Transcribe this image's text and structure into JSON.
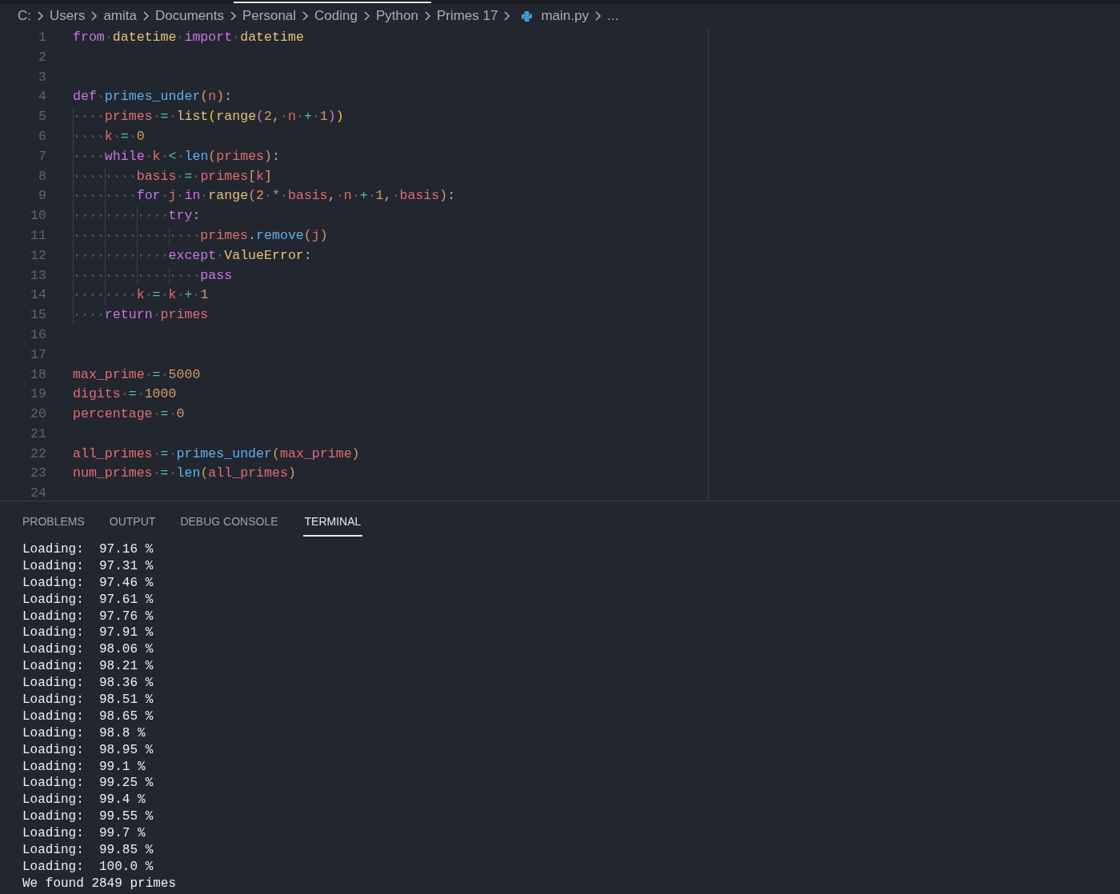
{
  "breadcrumb": [
    {
      "label": "C:",
      "kind": "folder"
    },
    {
      "label": "Users",
      "kind": "folder"
    },
    {
      "label": "amita",
      "kind": "folder"
    },
    {
      "label": "Documents",
      "kind": "folder"
    },
    {
      "label": "Personal",
      "kind": "folder"
    },
    {
      "label": "Coding",
      "kind": "folder"
    },
    {
      "label": "Python",
      "kind": "folder"
    },
    {
      "label": "Primes 17",
      "kind": "folder"
    },
    {
      "label": "main.py",
      "kind": "file"
    },
    {
      "label": "...",
      "kind": "more"
    }
  ],
  "editor": {
    "lines": [
      {
        "number": "1",
        "tokens": [
          {
            "text": "from",
            "kind": "kw"
          },
          {
            "text": " datetime",
            "kind": "type"
          },
          {
            "text": " import",
            "kind": "kw"
          },
          {
            "text": " datetime",
            "kind": "type"
          }
        ]
      },
      {
        "number": "2"
      },
      {
        "number": "3"
      },
      {
        "number": "4",
        "tokens": [
          {
            "text": "def",
            "kind": "kw"
          },
          {
            "text": " primes_under",
            "kind": "fn"
          },
          {
            "text": "(",
            "kind": "paren"
          },
          {
            "text": "n",
            "kind": "var"
          },
          {
            "text": ")",
            "kind": "paren"
          },
          {
            "text": ":",
            "kind": "punc"
          }
        ]
      },
      {
        "number": "5",
        "tokens": [
          {
            "text": "    primes",
            "kind": "var"
          },
          {
            "text": " =",
            "kind": "op"
          },
          {
            "text": " list",
            "kind": "type"
          },
          {
            "text": "(",
            "kind": "b1"
          },
          {
            "text": "range",
            "kind": "type"
          },
          {
            "text": "(",
            "kind": "b2"
          },
          {
            "text": "2",
            "kind": "num"
          },
          {
            "text": ",",
            "kind": "punc"
          },
          {
            "text": " n",
            "kind": "var"
          },
          {
            "text": " +",
            "kind": "op"
          },
          {
            "text": " 1",
            "kind": "num"
          },
          {
            "text": ")",
            "kind": "b2"
          },
          {
            "text": ")",
            "kind": "b1"
          }
        ]
      },
      {
        "number": "6",
        "tokens": [
          {
            "text": "    k",
            "kind": "var"
          },
          {
            "text": " =",
            "kind": "op"
          },
          {
            "text": " 0",
            "kind": "num"
          }
        ]
      },
      {
        "number": "7",
        "tokens": [
          {
            "text": "    while",
            "kind": "kw"
          },
          {
            "text": " k",
            "kind": "var"
          },
          {
            "text": " <",
            "kind": "op"
          },
          {
            "text": " len",
            "kind": "fn"
          },
          {
            "text": "(",
            "kind": "paren"
          },
          {
            "text": "primes",
            "kind": "var"
          },
          {
            "text": ")",
            "kind": "paren"
          },
          {
            "text": ":",
            "kind": "punc"
          }
        ]
      },
      {
        "number": "8",
        "tokens": [
          {
            "text": "        basis",
            "kind": "var"
          },
          {
            "text": " =",
            "kind": "op"
          },
          {
            "text": " primes",
            "kind": "var"
          },
          {
            "text": "[",
            "kind": "paren"
          },
          {
            "text": "k",
            "kind": "var"
          },
          {
            "text": "]",
            "kind": "paren"
          }
        ]
      },
      {
        "number": "9",
        "tokens": [
          {
            "text": "        for",
            "kind": "kw"
          },
          {
            "text": " j",
            "kind": "var"
          },
          {
            "text": " in",
            "kind": "kw"
          },
          {
            "text": " range",
            "kind": "type"
          },
          {
            "text": "(",
            "kind": "paren"
          },
          {
            "text": "2",
            "kind": "num"
          },
          {
            "text": " *",
            "kind": "op"
          },
          {
            "text": " basis",
            "kind": "var"
          },
          {
            "text": ",",
            "kind": "punc"
          },
          {
            "text": " n",
            "kind": "var"
          },
          {
            "text": " +",
            "kind": "op"
          },
          {
            "text": " 1",
            "kind": "num"
          },
          {
            "text": ",",
            "kind": "punc"
          },
          {
            "text": " basis",
            "kind": "var"
          },
          {
            "text": ")",
            "kind": "paren"
          },
          {
            "text": ":",
            "kind": "punc"
          }
        ]
      },
      {
        "number": "10",
        "tokens": [
          {
            "text": "            try",
            "kind": "kw"
          },
          {
            "text": ":",
            "kind": "punc"
          }
        ]
      },
      {
        "number": "11",
        "tokens": [
          {
            "text": "                primes",
            "kind": "var"
          },
          {
            "text": ".",
            "kind": "punc"
          },
          {
            "text": "remove",
            "kind": "fn"
          },
          {
            "text": "(",
            "kind": "paren"
          },
          {
            "text": "j",
            "kind": "var"
          },
          {
            "text": ")",
            "kind": "paren"
          }
        ]
      },
      {
        "number": "12",
        "tokens": [
          {
            "text": "            except",
            "kind": "kw"
          },
          {
            "text": " ValueError",
            "kind": "type"
          },
          {
            "text": ":",
            "kind": "punc"
          }
        ]
      },
      {
        "number": "13",
        "tokens": [
          {
            "text": "                pass",
            "kind": "kw"
          }
        ]
      },
      {
        "number": "14",
        "tokens": [
          {
            "text": "        k",
            "kind": "var"
          },
          {
            "text": " =",
            "kind": "op"
          },
          {
            "text": " k",
            "kind": "var"
          },
          {
            "text": " +",
            "kind": "op"
          },
          {
            "text": " 1",
            "kind": "num"
          }
        ]
      },
      {
        "number": "15",
        "tokens": [
          {
            "text": "    return",
            "kind": "kw"
          },
          {
            "text": " primes",
            "kind": "var"
          }
        ]
      },
      {
        "number": "16"
      },
      {
        "number": "17"
      },
      {
        "number": "18",
        "tokens": [
          {
            "text": "max_prime",
            "kind": "var"
          },
          {
            "text": " =",
            "kind": "op"
          },
          {
            "text": " 5000",
            "kind": "num"
          }
        ]
      },
      {
        "number": "19",
        "tokens": [
          {
            "text": "digits",
            "kind": "var"
          },
          {
            "text": " =",
            "kind": "op"
          },
          {
            "text": " 1000",
            "kind": "num"
          }
        ]
      },
      {
        "number": "20",
        "tokens": [
          {
            "text": "percentage",
            "kind": "var"
          },
          {
            "text": " =",
            "kind": "op"
          },
          {
            "text": " 0",
            "kind": "num"
          }
        ]
      },
      {
        "number": "21"
      },
      {
        "number": "22",
        "tokens": [
          {
            "text": "all_primes",
            "kind": "var"
          },
          {
            "text": " =",
            "kind": "op"
          },
          {
            "text": " primes_under",
            "kind": "fn"
          },
          {
            "text": "(",
            "kind": "paren"
          },
          {
            "text": "max_prime",
            "kind": "var"
          },
          {
            "text": ")",
            "kind": "paren"
          }
        ]
      },
      {
        "number": "23",
        "tokens": [
          {
            "text": "num_primes",
            "kind": "var"
          },
          {
            "text": " =",
            "kind": "op"
          },
          {
            "text": " len",
            "kind": "fn"
          },
          {
            "text": "(",
            "kind": "paren"
          },
          {
            "text": "all_primes",
            "kind": "var"
          },
          {
            "text": ")",
            "kind": "paren"
          }
        ]
      },
      {
        "number": "24"
      }
    ]
  },
  "panel": {
    "tabs": [
      {
        "label": "PROBLEMS",
        "selected": false
      },
      {
        "label": "OUTPUT",
        "selected": false
      },
      {
        "label": "DEBUG CONSOLE",
        "selected": false
      },
      {
        "label": "TERMINAL",
        "selected": true
      }
    ],
    "terminal_lines": [
      "Loading:  97.16 %",
      "Loading:  97.31 %",
      "Loading:  97.46 %",
      "Loading:  97.61 %",
      "Loading:  97.76 %",
      "Loading:  97.91 %",
      "Loading:  98.06 %",
      "Loading:  98.21 %",
      "Loading:  98.36 %",
      "Loading:  98.51 %",
      "Loading:  98.65 %",
      "Loading:  98.8 %",
      "Loading:  98.95 %",
      "Loading:  99.1 %",
      "Loading:  99.25 %",
      "Loading:  99.4 %",
      "Loading:  99.55 %",
      "Loading:  99.7 %",
      "Loading:  99.85 %",
      "Loading:  100.0 %",
      "We found 2849 primes"
    ]
  }
}
